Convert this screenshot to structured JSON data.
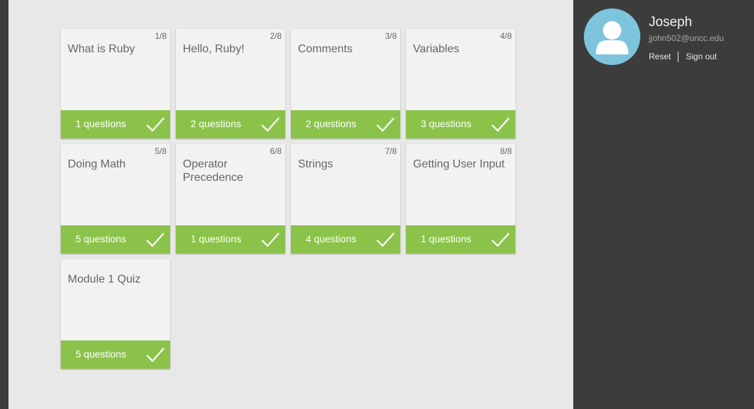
{
  "modules": [
    {
      "title": "What is Ruby",
      "counter": "1/8",
      "questions": "1 questions"
    },
    {
      "title": "Hello, Ruby!",
      "counter": "2/8",
      "questions": "2 questions"
    },
    {
      "title": "Comments",
      "counter": "3/8",
      "questions": "2 questions"
    },
    {
      "title": "Variables",
      "counter": "4/8",
      "questions": "3 questions"
    },
    {
      "title": "Doing Math",
      "counter": "5/8",
      "questions": "5 questions"
    },
    {
      "title": "Operator Precedence",
      "counter": "6/8",
      "questions": "1 questions"
    },
    {
      "title": "Strings",
      "counter": "7/8",
      "questions": "4 questions"
    },
    {
      "title": "Getting User Input",
      "counter": "8/8",
      "questions": "1 questions"
    },
    {
      "title": "Module 1 Quiz",
      "counter": "",
      "questions": "5 questions"
    }
  ],
  "user": {
    "name": "Joseph",
    "email": "jjohn502@uncc.edu",
    "reset_label": "Reset",
    "signout_label": "Sign out"
  },
  "colors": {
    "accent_green": "#8bc34a",
    "sidebar_bg": "#3c3c3c",
    "avatar_bg": "#7ec4dc"
  },
  "icons": {
    "completed": "checkmark-icon",
    "avatar": "user-avatar-icon"
  }
}
